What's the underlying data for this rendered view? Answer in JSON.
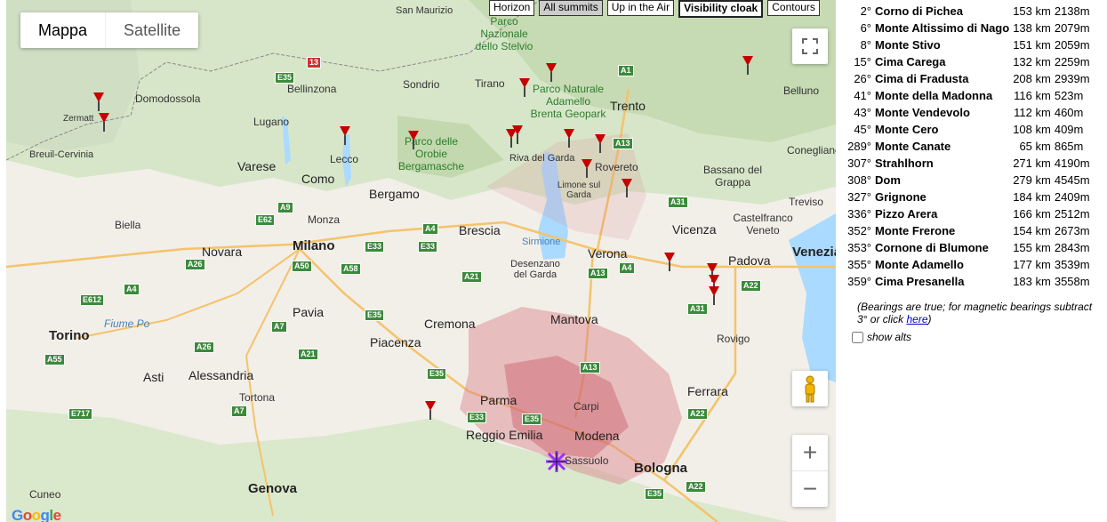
{
  "map_types": {
    "map": "Mappa",
    "satellite": "Satellite",
    "active": "map"
  },
  "toolbar": [
    "Horizon",
    "All summits",
    "Up in the Air",
    "Visibility cloak",
    "Contours"
  ],
  "map_labels": {
    "cities": [
      "Milano",
      "Torino",
      "Genova",
      "Bologna",
      "Verona",
      "Brescia",
      "Bergamo",
      "Parma",
      "Modena",
      "Mantova",
      "Cremona",
      "Piacenza",
      "Pavia",
      "Novara",
      "Alessandria",
      "Asti",
      "Cuneo",
      "Ferrara",
      "Padova",
      "Vicenza",
      "Trento",
      "Rovereto",
      "Lecco",
      "Como",
      "Varese",
      "Lugano",
      "Monza",
      "Biella",
      "Tortona",
      "Carpi",
      "Rovigo",
      "Treviso",
      "Belluno",
      "Bellinzona",
      "Domodossola",
      "Zermatt",
      "Sondrio",
      "Tirano",
      "Riva del Garda",
      "Sirmione",
      "Desenzano del Garda",
      "Reggio Emilia",
      "Sassuolo",
      "Bassano del Grappa",
      "Castelfranco Veneto",
      "Conegliano",
      "Breuil-Cervinia",
      "San Maurizio",
      "Venezia"
    ],
    "parks": [
      "Parco Nazionale dello Stelvio",
      "Parco Naturale Adamello Brenta Geopark",
      "Parco delle Orobie Bergamasche",
      "Limone sul Garda"
    ],
    "water": [
      "Fiume Po"
    ],
    "roads": [
      "E35",
      "A4",
      "A1",
      "A22",
      "A13",
      "A26",
      "A7",
      "A21",
      "E62",
      "A9",
      "A31",
      "A35",
      "A50",
      "A58",
      "E612",
      "E717",
      "A55",
      "A33",
      "E33",
      "13"
    ]
  },
  "sidebar": {
    "peaks": [
      {
        "bearing": "2°",
        "name": "Corno di Pichea",
        "dist": "153 km",
        "alt": "2138m"
      },
      {
        "bearing": "6°",
        "name": "Monte Altissimo di Nago",
        "dist": "138 km",
        "alt": "2079m"
      },
      {
        "bearing": "8°",
        "name": "Monte Stivo",
        "dist": "151 km",
        "alt": "2059m"
      },
      {
        "bearing": "15°",
        "name": "Cima Carega",
        "dist": "132 km",
        "alt": "2259m"
      },
      {
        "bearing": "26°",
        "name": "Cima di Fradusta",
        "dist": "208 km",
        "alt": "2939m"
      },
      {
        "bearing": "41°",
        "name": "Monte della Madonna",
        "dist": "116 km",
        "alt": "523m"
      },
      {
        "bearing": "43°",
        "name": "Monte Vendevolo",
        "dist": "112 km",
        "alt": "460m"
      },
      {
        "bearing": "45°",
        "name": "Monte Cero",
        "dist": "108 km",
        "alt": "409m"
      },
      {
        "bearing": "289°",
        "name": "Monte Canate",
        "dist": "65 km",
        "alt": "865m"
      },
      {
        "bearing": "307°",
        "name": "Strahlhorn",
        "dist": "271 km",
        "alt": "4190m"
      },
      {
        "bearing": "308°",
        "name": "Dom",
        "dist": "279 km",
        "alt": "4545m"
      },
      {
        "bearing": "327°",
        "name": "Grignone",
        "dist": "184 km",
        "alt": "2409m"
      },
      {
        "bearing": "336°",
        "name": "Pizzo Arera",
        "dist": "166 km",
        "alt": "2512m"
      },
      {
        "bearing": "352°",
        "name": "Monte Frerone",
        "dist": "154 km",
        "alt": "2673m"
      },
      {
        "bearing": "353°",
        "name": "Cornone di Blumone",
        "dist": "155 km",
        "alt": "2843m"
      },
      {
        "bearing": "355°",
        "name": "Monte Adamello",
        "dist": "177 km",
        "alt": "3539m"
      },
      {
        "bearing": "359°",
        "name": "Cima Presanella",
        "dist": "183 km",
        "alt": "3558m"
      }
    ],
    "note_text": "(Bearings are true; for magnetic bearings subtract 3° or click ",
    "note_link": "here",
    "note_end": ")",
    "show_alts_label": "show alts",
    "show_alts_checked": false
  },
  "colors": {
    "marker": "#c40000",
    "cloak": "#d9818a",
    "viewpoint": "#9b30ff"
  }
}
